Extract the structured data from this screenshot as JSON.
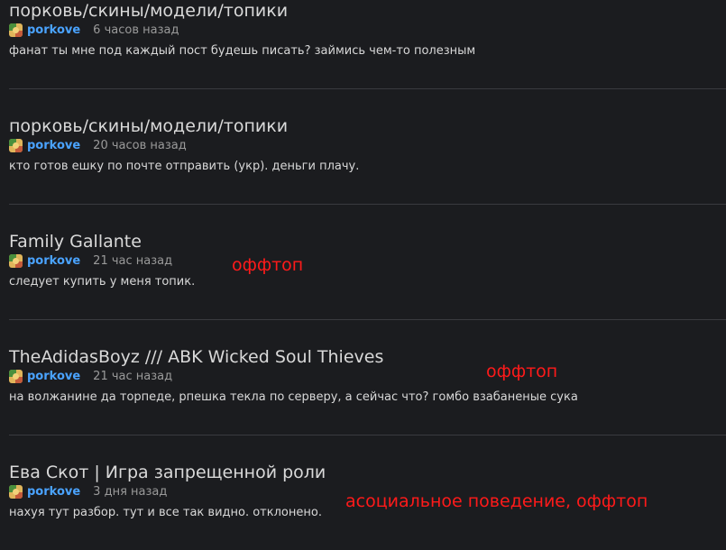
{
  "posts": [
    {
      "title": "порковь/скины/модели/топики",
      "author": "porkove",
      "time": "6 часов назад",
      "body": "фанат ты мне под каждый пост будешь писать? займись чем-то полезным"
    },
    {
      "title": "порковь/скины/модели/топики",
      "author": "porkove",
      "time": "20 часов назад",
      "body": "кто готов ешку по почте отправить (укр). деньги плачу."
    },
    {
      "title": "Family Gallante",
      "author": "porkove",
      "time": "21 час назад",
      "body": "следует купить у меня топик."
    },
    {
      "title": "TheAdidasBoyz /// ABK Wicked Soul Thieves",
      "author": "porkove",
      "time": "21 час назад",
      "body": "на волжанине да торпеде, рпешка текла по серверу, а сейчас что? гомбо взабаненые сука"
    },
    {
      "title": "Ева Скот | Игра запрещенной роли",
      "author": "porkove",
      "time": "3 дня назад",
      "body": "нахуя тут разбор. тут и все так видно. отклонено."
    }
  ],
  "annotations": {
    "a1": "оффтоп",
    "a2": "оффтоп",
    "a3": "асоциальное поведение, оффтоп"
  },
  "colors": {
    "background": "#1b1c1f",
    "author": "#4aa3ff",
    "annotation": "#ff1a1a",
    "divider": "#3a3b3f"
  }
}
